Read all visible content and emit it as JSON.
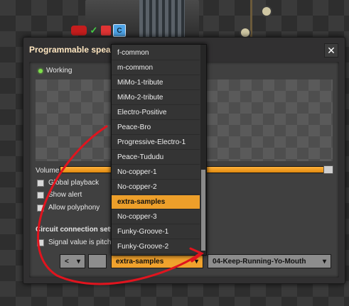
{
  "window": {
    "title": "Programmable spea",
    "close_glyph": "✕"
  },
  "status": {
    "text": "Working"
  },
  "volume": {
    "label": "Volume",
    "level": 0.98
  },
  "options": [
    {
      "label": "Global playback"
    },
    {
      "label": "Show alert"
    },
    {
      "label": "Allow polyphony"
    }
  ],
  "circuit": {
    "heading": "Circuit connection setti",
    "signal_label": "Signal value is pitch"
  },
  "controls": {
    "prev_label": "<",
    "chevron": "▾"
  },
  "instrument": {
    "selected": "extra-samples"
  },
  "note": {
    "selected": "04-Keep-Running-Yo-Mouth"
  },
  "dropdown_items": [
    "f-common",
    "m-common",
    "MiMo-1-tribute",
    "MiMo-2-tribute",
    "Electro-Positive",
    "Peace-Bro",
    "Progressive-Electro-1",
    "Peace-Tududu",
    "No-copper-1",
    "No-copper-2",
    "extra-samples",
    "No-copper-3",
    "Funky-Groove-1",
    "Funky-Groove-2"
  ],
  "alert_icons": {
    "check": "✓",
    "signal": "C"
  },
  "colors": {
    "accent": "#ed9f2a",
    "annotation": "#e0141e",
    "marker_yellow": "#e8e23a",
    "marker_blue": "#5b7fb8"
  }
}
